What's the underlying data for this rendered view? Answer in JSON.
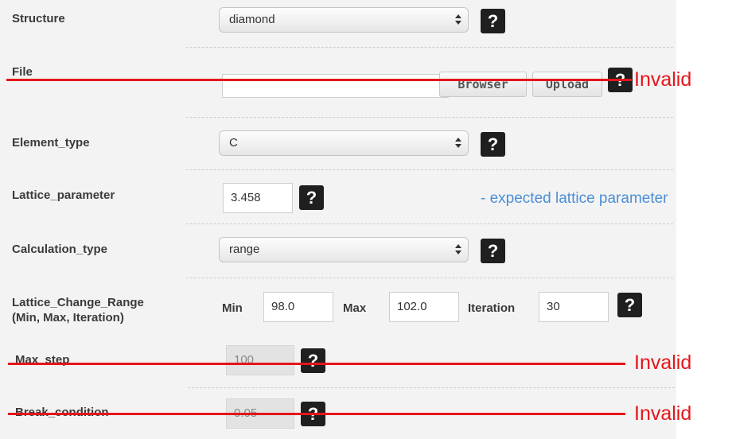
{
  "rows": {
    "structure": {
      "label": "Structure",
      "value": "diamond",
      "help": "?"
    },
    "file": {
      "label": "File",
      "browse_label": "Browser",
      "upload_label": "Upload",
      "help": "?",
      "status": "Invalid"
    },
    "element_type": {
      "label": "Element_type",
      "value": "C",
      "help": "?"
    },
    "lattice_parameter": {
      "label": "Lattice_parameter",
      "value": "3.458",
      "help": "?",
      "hint": "- expected lattice parameter"
    },
    "calculation_type": {
      "label": "Calculation_type",
      "value": "range",
      "help": "?"
    },
    "lattice_change_range": {
      "label_line1": "Lattice_Change_Range",
      "label_line2": "(Min, Max, Iteration)",
      "min_label": "Min",
      "min_value": "98.0",
      "max_label": "Max",
      "max_value": "102.0",
      "iteration_label": "Iteration",
      "iteration_value": "30",
      "help": "?"
    },
    "max_step": {
      "label": "Max_step",
      "value": "100",
      "help": "?",
      "status": "Invalid"
    },
    "break_condition": {
      "label": "Break_condition",
      "value": "0.05",
      "help": "?",
      "status": "Invalid"
    }
  },
  "colors": {
    "invalid_annotation": "#e4161b",
    "hint_text": "#4a8fd6",
    "help_button": "#1f1f1f",
    "panel_background": "#f4f3f3"
  }
}
